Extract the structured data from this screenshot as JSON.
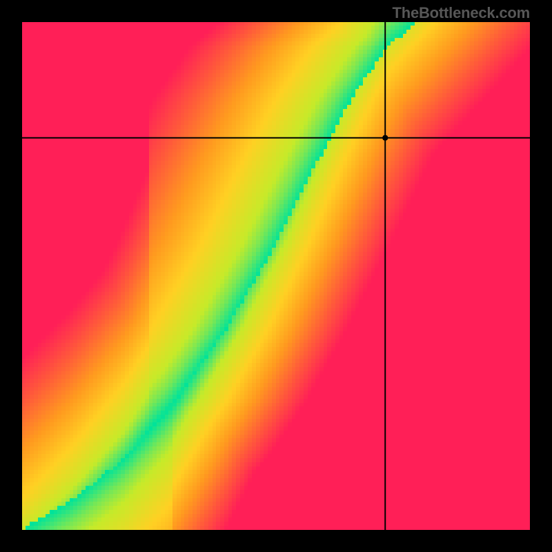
{
  "watermark": "TheBottleneck.com",
  "chart_data": {
    "type": "heatmap",
    "title": "",
    "xlabel": "",
    "ylabel": "",
    "xlim": [
      0,
      1
    ],
    "ylim": [
      0,
      1
    ],
    "crosshair": {
      "x": 0.715,
      "y": 0.772
    },
    "marker": {
      "x": 0.715,
      "y": 0.772,
      "radius": 4
    },
    "ridge": {
      "description": "Narrow green optimal band running from bottom-left to top-right through a red-orange-yellow gradient field. Values represent distance-to-optimal (0 = green, ~1 = red).",
      "control_points_xy": [
        [
          0.0,
          0.0
        ],
        [
          0.1,
          0.06
        ],
        [
          0.2,
          0.14
        ],
        [
          0.3,
          0.25
        ],
        [
          0.4,
          0.39
        ],
        [
          0.5,
          0.56
        ],
        [
          0.58,
          0.72
        ],
        [
          0.65,
          0.85
        ],
        [
          0.72,
          0.95
        ],
        [
          0.78,
          1.0
        ]
      ],
      "band_halfwidth_normalized": 0.045
    },
    "colorscale": [
      {
        "t": 0.0,
        "color": "#00e39a"
      },
      {
        "t": 0.2,
        "color": "#c6ea29"
      },
      {
        "t": 0.4,
        "color": "#ffd023"
      },
      {
        "t": 0.6,
        "color": "#ff9a1f"
      },
      {
        "t": 0.8,
        "color": "#ff5a3a"
      },
      {
        "t": 1.0,
        "color": "#ff1f57"
      }
    ],
    "pixelation": 128
  }
}
